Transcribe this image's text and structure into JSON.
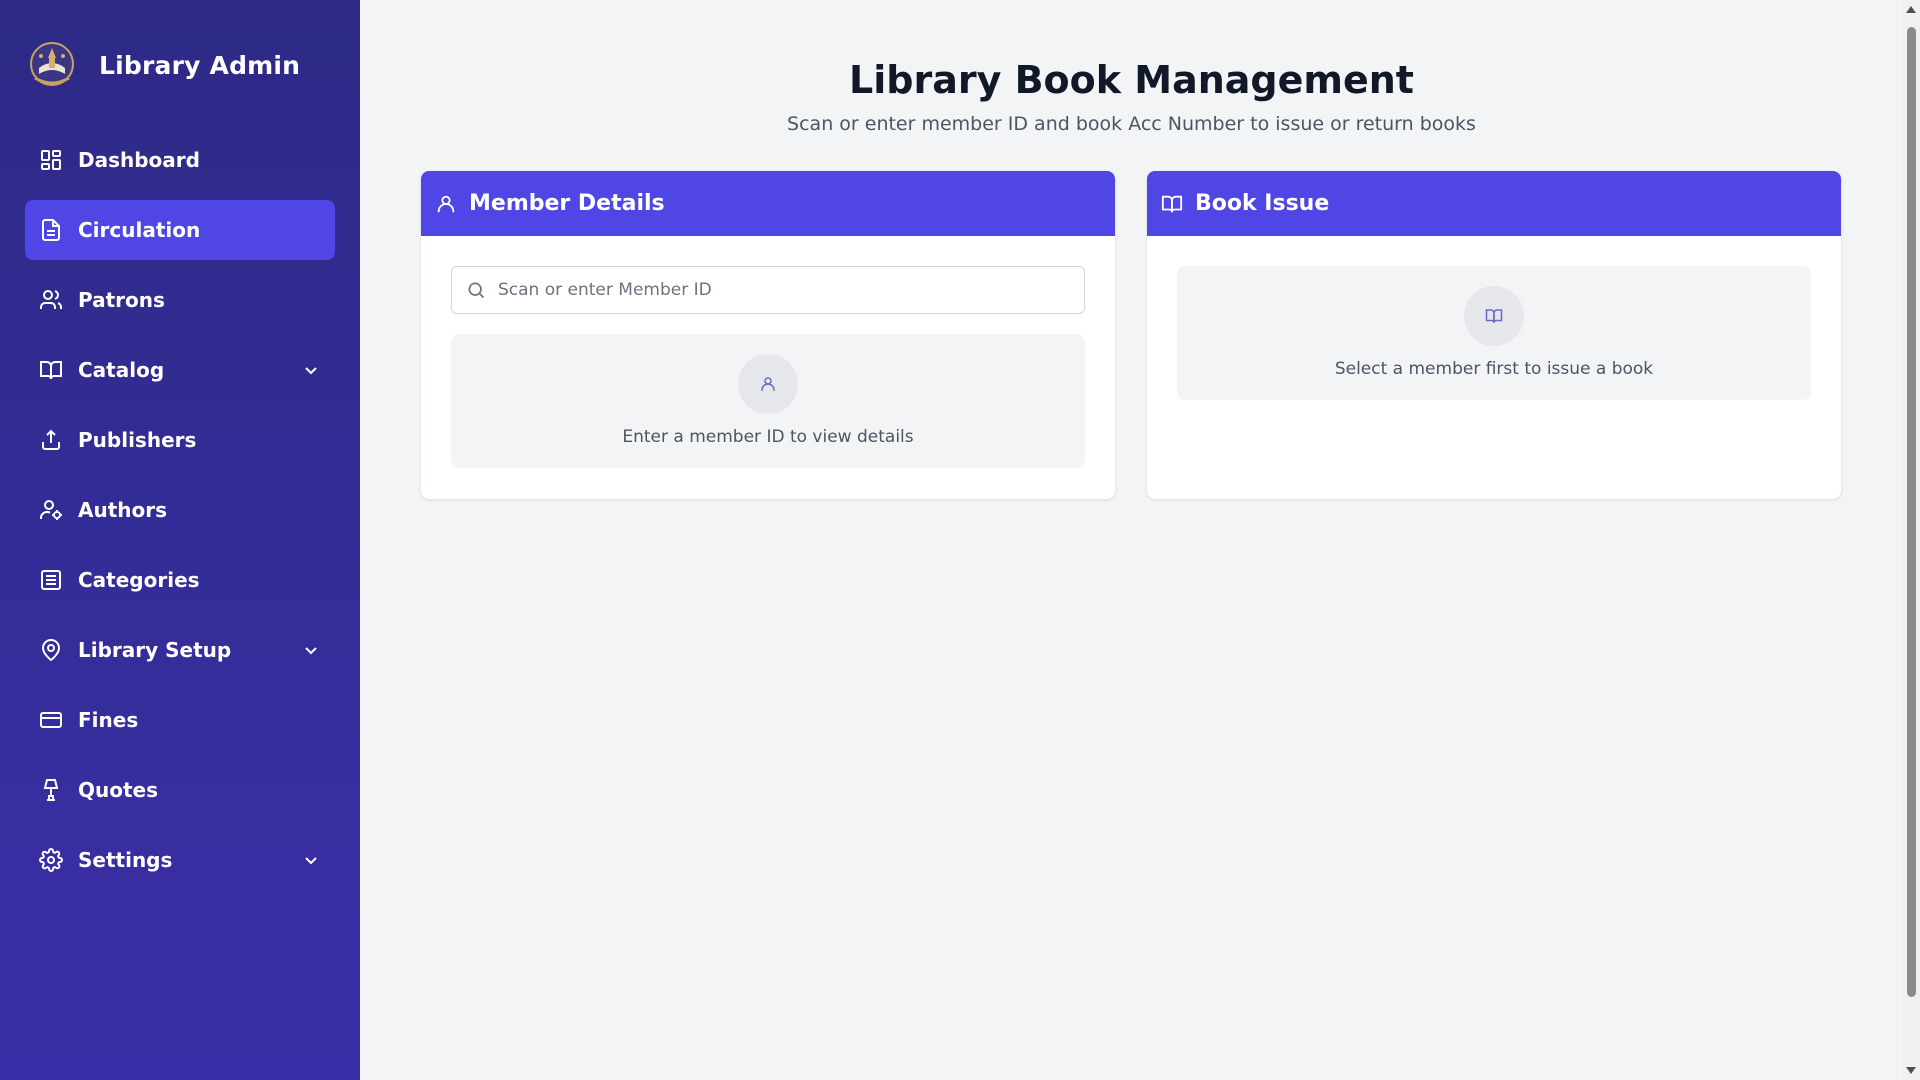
{
  "sidebar": {
    "brand_title": "Library Admin",
    "brand_logo": "library-crest-logo",
    "items": [
      {
        "label": "Dashboard",
        "icon": "dashboard-icon",
        "active": false,
        "has_submenu": false
      },
      {
        "label": "Circulation",
        "icon": "document-icon",
        "active": true,
        "has_submenu": false
      },
      {
        "label": "Patrons",
        "icon": "users-icon",
        "active": false,
        "has_submenu": false
      },
      {
        "label": "Catalog",
        "icon": "book-open-icon",
        "active": false,
        "has_submenu": true
      },
      {
        "label": "Publishers",
        "icon": "upload-icon",
        "active": false,
        "has_submenu": false
      },
      {
        "label": "Authors",
        "icon": "user-cog-icon",
        "active": false,
        "has_submenu": false
      },
      {
        "label": "Categories",
        "icon": "list-icon",
        "active": false,
        "has_submenu": false
      },
      {
        "label": "Library Setup",
        "icon": "map-pin-icon",
        "active": false,
        "has_submenu": true
      },
      {
        "label": "Fines",
        "icon": "credit-card-icon",
        "active": false,
        "has_submenu": false
      },
      {
        "label": "Quotes",
        "icon": "lamp-icon",
        "active": false,
        "has_submenu": false
      },
      {
        "label": "Settings",
        "icon": "gear-icon",
        "active": false,
        "has_submenu": true
      }
    ]
  },
  "main": {
    "title": "Library Book Management",
    "subtitle": "Scan or enter member ID and book Acc Number to issue or return books",
    "member_card": {
      "title": "Member Details",
      "icon": "user-icon",
      "search_placeholder": "Scan or enter Member ID",
      "search_value": "",
      "empty_icon": "user-icon",
      "empty_text": "Enter a member ID to view details"
    },
    "issue_card": {
      "title": "Book Issue",
      "icon": "book-open-icon",
      "empty_icon": "book-open-icon",
      "empty_text": "Select a member first to issue a book"
    }
  },
  "colors": {
    "sidebar_bg": "#2e2a86",
    "accent": "#4f46e5",
    "page_bg": "#f3f4f6",
    "title_text": "#111827"
  }
}
